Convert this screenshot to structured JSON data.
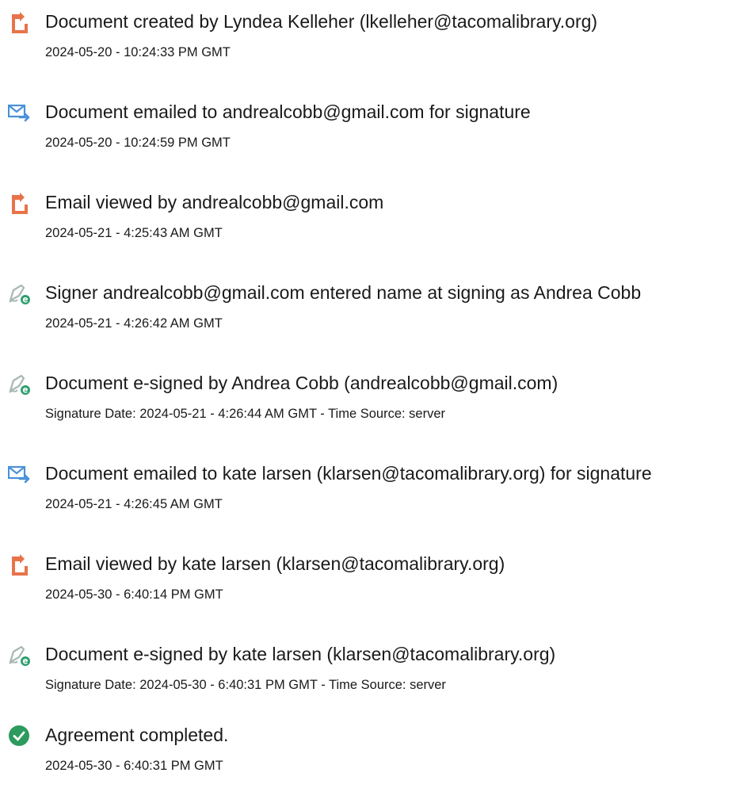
{
  "events": [
    {
      "icon": "document-icon",
      "title": "Document created by Lyndea Kelleher (lkelleher@tacomalibrary.org)",
      "time": "2024-05-20 - 10:24:33 PM GMT"
    },
    {
      "icon": "email-sent-icon",
      "title": "Document emailed to andrealcobb@gmail.com for signature",
      "time": "2024-05-20 - 10:24:59 PM GMT"
    },
    {
      "icon": "document-icon",
      "title": "Email viewed by andrealcobb@gmail.com",
      "time": "2024-05-21 - 4:25:43 AM GMT"
    },
    {
      "icon": "esign-pen-icon",
      "title": "Signer andrealcobb@gmail.com entered name at signing as Andrea Cobb",
      "time": "2024-05-21 - 4:26:42 AM GMT"
    },
    {
      "icon": "esign-pen-icon",
      "title": "Document e-signed by Andrea Cobb (andrealcobb@gmail.com)",
      "time": "Signature Date: 2024-05-21 - 4:26:44 AM GMT - Time Source: server"
    },
    {
      "icon": "email-sent-icon",
      "title": "Document emailed to kate larsen (klarsen@tacomalibrary.org) for signature",
      "time": "2024-05-21 - 4:26:45 AM GMT"
    },
    {
      "icon": "document-icon",
      "title": "Email viewed by kate larsen (klarsen@tacomalibrary.org)",
      "time": "2024-05-30 - 6:40:14 PM GMT"
    },
    {
      "icon": "esign-pen-icon",
      "title": "Document e-signed by kate larsen (klarsen@tacomalibrary.org)",
      "time": "Signature Date: 2024-05-30 - 6:40:31 PM GMT - Time Source: server"
    },
    {
      "icon": "check-circle-icon",
      "title": "Agreement completed.",
      "time": "2024-05-30 - 6:40:31 PM GMT"
    }
  ],
  "colors": {
    "document_icon": "#e8734a",
    "email_icon": "#4a90d9",
    "pen_icon": "#2e9e6e",
    "check_icon": "#2d9a5e",
    "text": "#1a1a1a"
  }
}
